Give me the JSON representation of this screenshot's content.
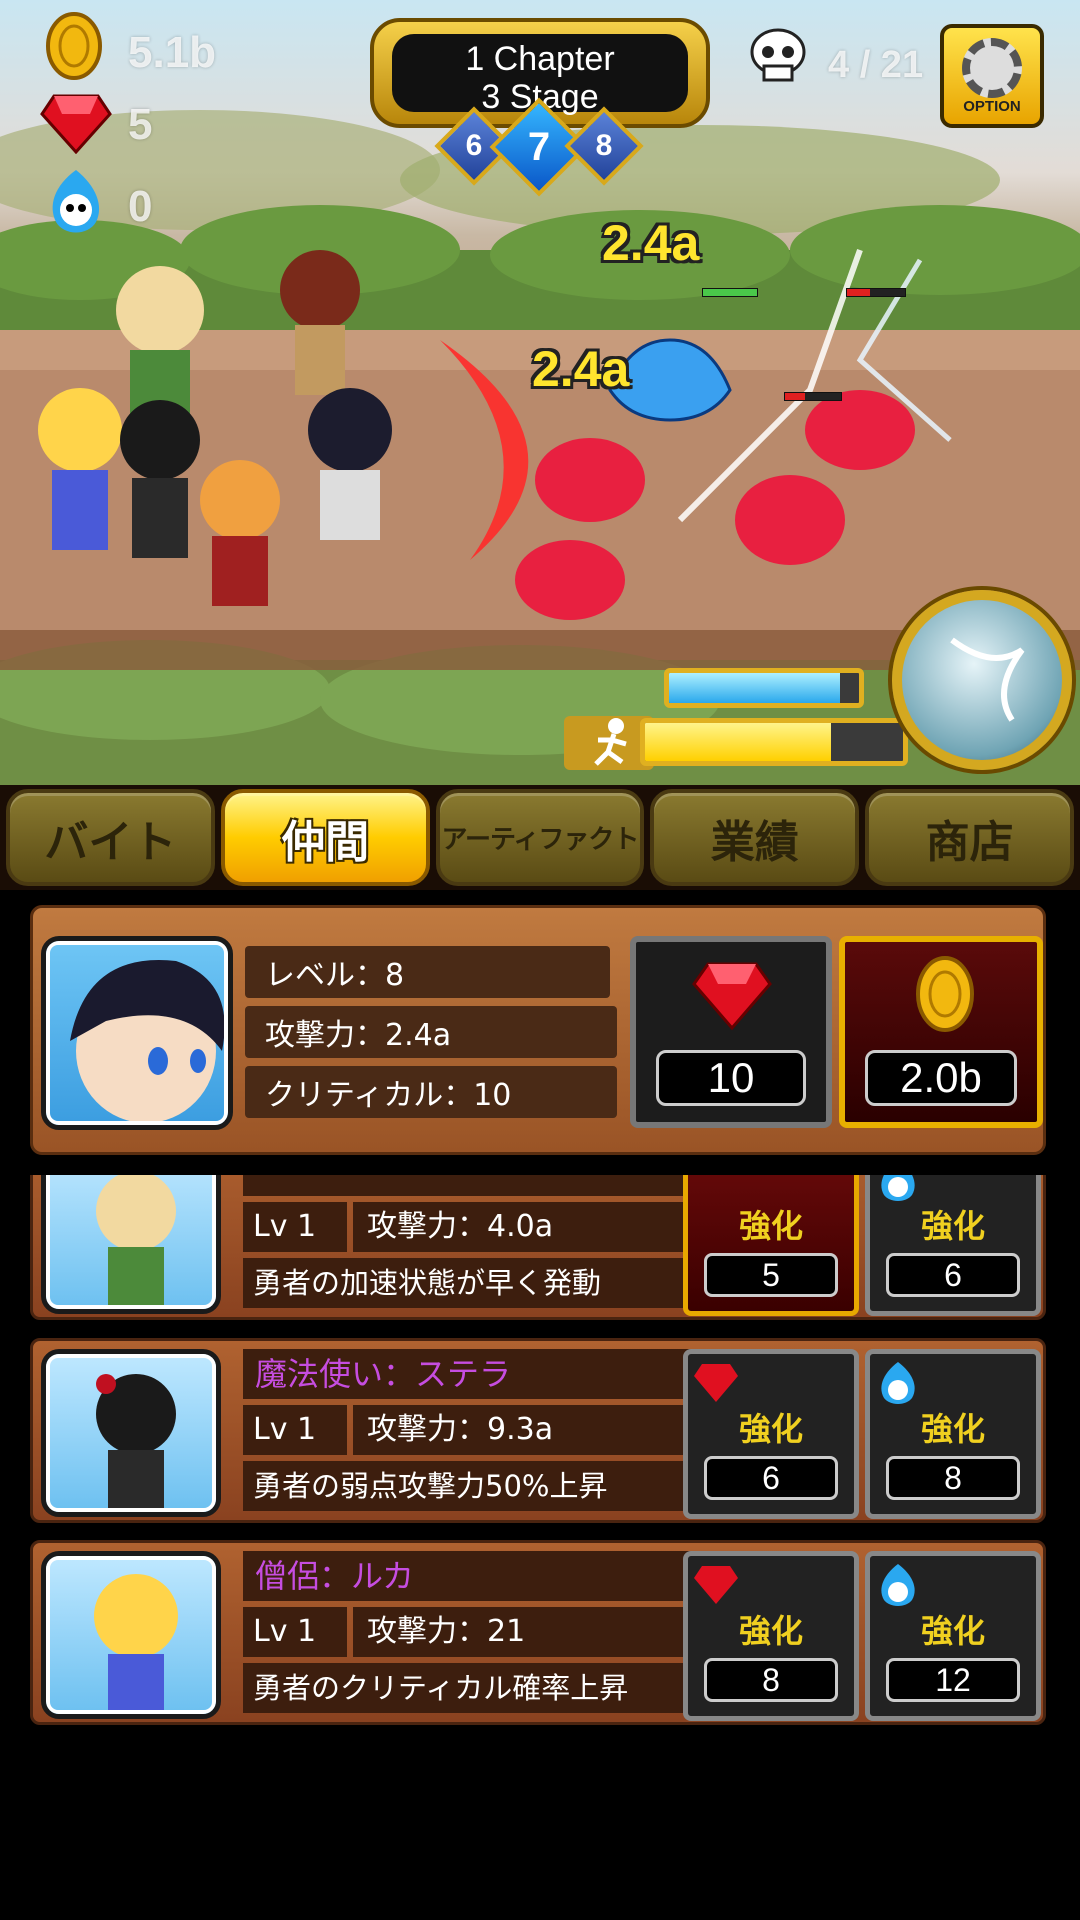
{
  "hud": {
    "gold": "5.1b",
    "gems": "5",
    "souls": "0",
    "chapter_line1": "1 Chapter",
    "chapter_line2": "3 Stage",
    "stage_prev": "6",
    "stage_current": "7",
    "stage_next": "8",
    "kills": "4 / 21",
    "option_label": "OPTION"
  },
  "battle": {
    "damage_popups": [
      "2.4a",
      "2.4a"
    ],
    "skill_gauge_fill": 0.9,
    "run_gauge_fill": 0.72
  },
  "tabs": [
    {
      "label": "バイト",
      "active": false
    },
    {
      "label": "仲間",
      "active": true
    },
    {
      "label": "アーティファクト",
      "active": false
    },
    {
      "label": "業績",
      "active": false
    },
    {
      "label": "商店",
      "active": false
    }
  ],
  "hero": {
    "level": "レベル：8",
    "attack": "攻撃力：2.4a",
    "critical": "クリティカル：10",
    "gem_cost": "10",
    "gold_cost": "2.0b"
  },
  "companions": [
    {
      "name": "",
      "level": "Lv 1",
      "attack": "攻撃力：4.0a",
      "desc": "勇者の加速状態が早く発動",
      "upgrade_label": "強化",
      "gem_cost": "5",
      "soul_cost": "6"
    },
    {
      "name": "魔法使い：ステラ",
      "level": "Lv 1",
      "attack": "攻撃力：9.3a",
      "desc": "勇者の弱点攻撃力50%上昇",
      "upgrade_label": "強化",
      "gem_cost": "6",
      "soul_cost": "8"
    },
    {
      "name": "僧侶：ルカ",
      "level": "Lv 1",
      "attack": "攻撃力：21",
      "desc": "勇者のクリティカル確率上昇",
      "upgrade_label": "強化",
      "gem_cost": "8",
      "soul_cost": "12"
    }
  ],
  "colors": {
    "accent_gold": "#ffcc00",
    "name_purple": "#c64de0",
    "damage_yellow": "#ffe52e"
  }
}
